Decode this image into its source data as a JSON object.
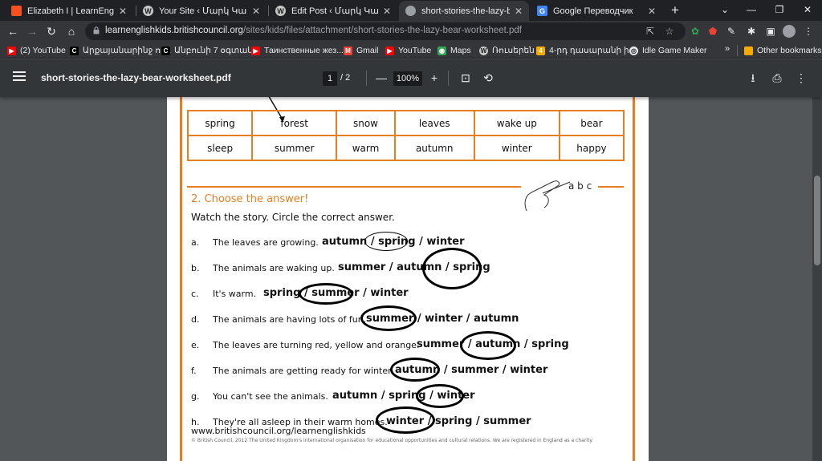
{
  "tabs": [
    {
      "title": "Elizabeth I | LearnEnglish Kids",
      "favicon": "grid-icon",
      "color": "#f4511e",
      "active": false
    },
    {
      "title": "Your Site ‹ Մարկ Կարդանյա",
      "favicon": "wordpress-icon",
      "color": "#c4c7c5",
      "active": false
    },
    {
      "title": "Edit Post ‹ Մարկ Կարդանյա",
      "favicon": "wordpress-icon",
      "color": "#c4c7c5",
      "active": false
    },
    {
      "title": "short-stories-the-lazy-bear-w",
      "favicon": "globe-icon",
      "color": "#9aa0a6",
      "active": true
    },
    {
      "title": "Google Переводчик",
      "favicon": "translate-icon",
      "color": "#4285f4",
      "active": false
    }
  ],
  "new_tab_label": "+",
  "address": {
    "host": "learnenglishkids.britishcouncil.org",
    "path": "/sites/kids/files/attachment/short-stories-the-lazy-bear-worksheet.pdf"
  },
  "bookmarks": [
    {
      "label": "(2) YouTube",
      "icon": "youtube-icon",
      "color": "#ff0000"
    },
    {
      "label": "Արքայանարինջ ու...",
      "icon": "bookmark-icon",
      "color": "#000000"
    },
    {
      "label": "Անբունի 7 օգտակ...",
      "icon": "bookmark-icon",
      "color": "#000000"
    },
    {
      "label": "Таинственные жез...",
      "icon": "youtube-icon",
      "color": "#ff0000"
    },
    {
      "label": "Gmail",
      "icon": "gmail-icon",
      "color": "#ea4335"
    },
    {
      "label": "YouTube",
      "icon": "youtube-icon",
      "color": "#ff0000"
    },
    {
      "label": "Maps",
      "icon": "maps-icon",
      "color": "#34a853"
    },
    {
      "label": "Ռուսերեն",
      "icon": "wordpress-icon",
      "color": "#c4c7c5"
    },
    {
      "label": "4-րդ դասարանի ի...",
      "icon": "bookmark-icon",
      "color": "#f9ab00"
    },
    {
      "label": "Idle Game Maker",
      "icon": "globe-icon",
      "color": "#e8eaed"
    }
  ],
  "bookmarks_more": "»",
  "other_bookmarks": "Other bookmarks",
  "pdf": {
    "filename": "short-stories-the-lazy-bear-worksheet.pdf",
    "page_current": "1",
    "page_total": "2",
    "zoom": "100%"
  },
  "worksheet": {
    "word_table": [
      [
        "spring",
        "forest",
        "snow",
        "leaves",
        "wake up",
        "bear"
      ],
      [
        "sleep",
        "summer",
        "warm",
        "autumn",
        "winter",
        "happy"
      ]
    ],
    "abc": "a b c",
    "section_title": "2. Choose the answer!",
    "instruction": "Watch the story. Circle the correct answer.",
    "questions": [
      {
        "letter": "a.",
        "text": "The leaves are growing.",
        "options": "autumn / spring / winter"
      },
      {
        "letter": "b.",
        "text": "The animals are waking up.",
        "options": "summer / autumn / spring"
      },
      {
        "letter": "c.",
        "text": "It's warm.",
        "options": "spring / summer / winter"
      },
      {
        "letter": "d.",
        "text": "The animals are having lots of fun.",
        "options": "summer / winter / autumn"
      },
      {
        "letter": "e.",
        "text": "The leaves are turning red, yellow and orange.",
        "options": "summer / autumn / spring"
      },
      {
        "letter": "f.",
        "text": "The animals are getting ready for winter.",
        "options": "autumn / summer / winter"
      },
      {
        "letter": "g.",
        "text": "You can't see the animals.",
        "options": "autumn / spring / winter"
      },
      {
        "letter": "h.",
        "text": "They're all asleep in their warm homes.",
        "options": "winter / spring / summer"
      }
    ],
    "footer_url": "www.britishcouncil.org/learnenglishkids",
    "footer_small": "© British Council, 2012 The United Kingdom's international organisation for educational opportunities and cultural relations. We are registered in England as a charity."
  }
}
